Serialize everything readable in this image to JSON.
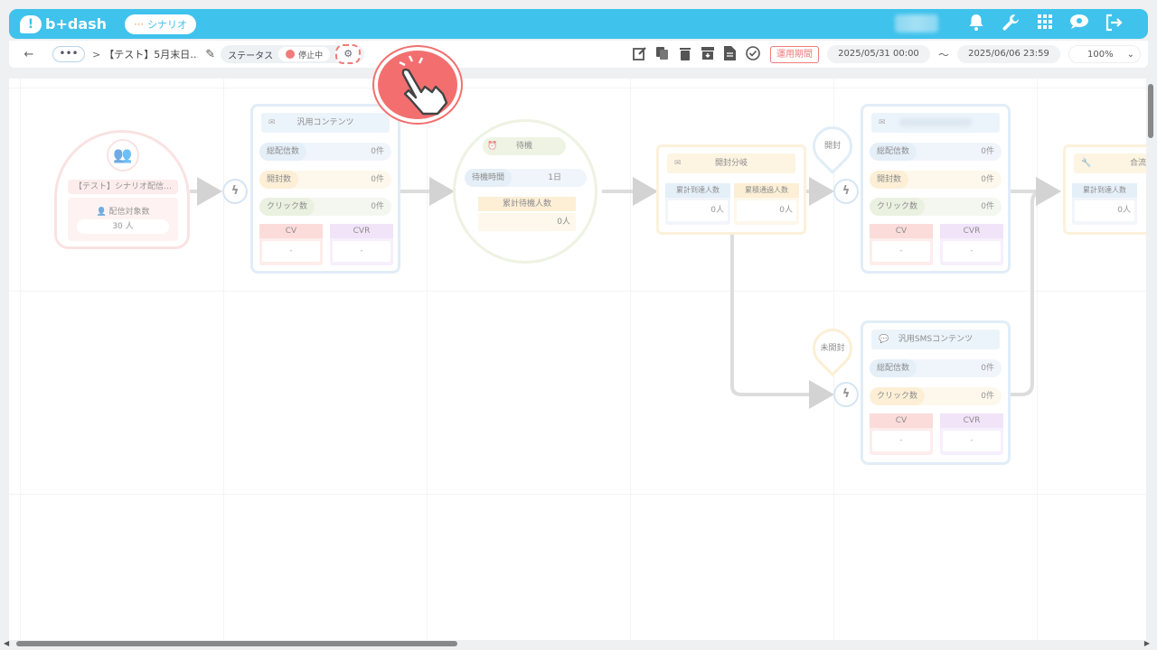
{
  "header": {
    "logo_mark": "!",
    "logo_text": "b+dash",
    "scenario_button": "シナリオ",
    "scenario_icon": "share-nodes-icon",
    "icons": [
      "bell-icon",
      "wrench-icon",
      "grid-icon",
      "support-chat-icon",
      "logout-icon"
    ],
    "accent": "#3fc2ec"
  },
  "toolbar": {
    "back": "←",
    "more": "•••",
    "separator": ">",
    "title": "【テスト】5月末日…",
    "status_label": "ステータス",
    "status_value": "停止中",
    "gear": "⚙",
    "period_button": "運用期間",
    "start_date": "2025/05/31 00:00",
    "tilde": "〜",
    "end_date": "2025/06/06 23:59",
    "zoom": "100%"
  },
  "start_node": {
    "name": "【テスト】シナリオ配信…",
    "target_label": "配信対象数",
    "target_value": "30 人"
  },
  "email_node": {
    "title": "汎用コンテンツ",
    "rows": [
      {
        "key": "総配信数",
        "value": "0件"
      },
      {
        "key": "開封数",
        "value": "0件"
      },
      {
        "key": "クリック数",
        "value": "0件"
      }
    ],
    "cv_label": "CV",
    "cv_value": "-",
    "cvr_label": "CVR",
    "cvr_value": "-"
  },
  "wait_node": {
    "title": "待機",
    "time_label": "待機時間",
    "time_value": "1日",
    "count_label": "累計待機人数",
    "count_value": "0人"
  },
  "branch_node": {
    "title": "開封分岐",
    "col1_label": "累計到達人数",
    "col1_value": "0人",
    "col2_label": "累積通過人数",
    "col2_value": "0人"
  },
  "open_pin": "開封",
  "unopened_pin": "未開封",
  "email_node_2": {
    "rows": [
      {
        "key": "総配信数",
        "value": "0件"
      },
      {
        "key": "開封数",
        "value": "0件"
      },
      {
        "key": "クリック数",
        "value": "0件"
      }
    ],
    "cv_label": "CV",
    "cv_value": "-",
    "cvr_label": "CVR",
    "cvr_value": "-"
  },
  "sms_node": {
    "title": "汎用SMSコンテンツ",
    "rows": [
      {
        "key": "総配信数",
        "value": "0件"
      },
      {
        "key": "クリック数",
        "value": "0件"
      }
    ],
    "cv_label": "CV",
    "cv_value": "-",
    "cvr_label": "CVR",
    "cvr_value": "-"
  },
  "merge_node": {
    "title": "合流",
    "col1_label": "累計到達人数",
    "col1_value": "0人"
  },
  "trigger_symbol": "ϟ"
}
